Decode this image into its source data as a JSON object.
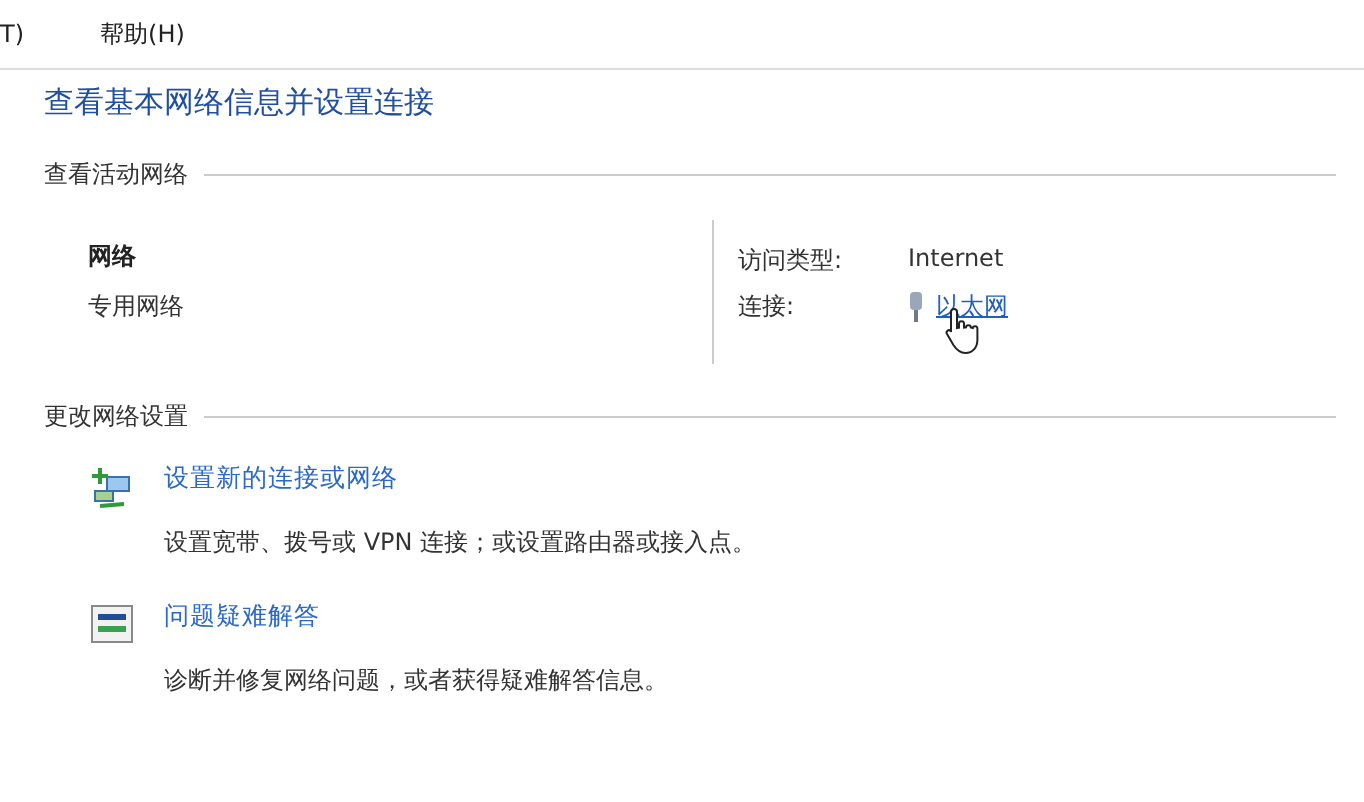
{
  "menu": [
    {
      "label": "T)"
    },
    {
      "label": "帮助(H)"
    }
  ],
  "title": "查看基本网络信息并设置连接",
  "active_networks": {
    "heading": "查看活动网络",
    "network_name": "网络",
    "network_type": "专用网络",
    "access_type_label": "访问类型:",
    "access_type": "Internet",
    "connections_label": "连接:",
    "connection": "以太网"
  },
  "change_settings": {
    "heading": "更改网络设置",
    "tasks": [
      {
        "kind": "new-connection",
        "link": "设置新的连接或网络",
        "description": "设置宽带、拨号或 VPN 连接；或设置路由器或接入点。"
      },
      {
        "kind": "troubleshoot",
        "link": "问题疑难解答",
        "description": "诊断并修复网络问题，或者获得疑难解答信息。"
      }
    ]
  }
}
